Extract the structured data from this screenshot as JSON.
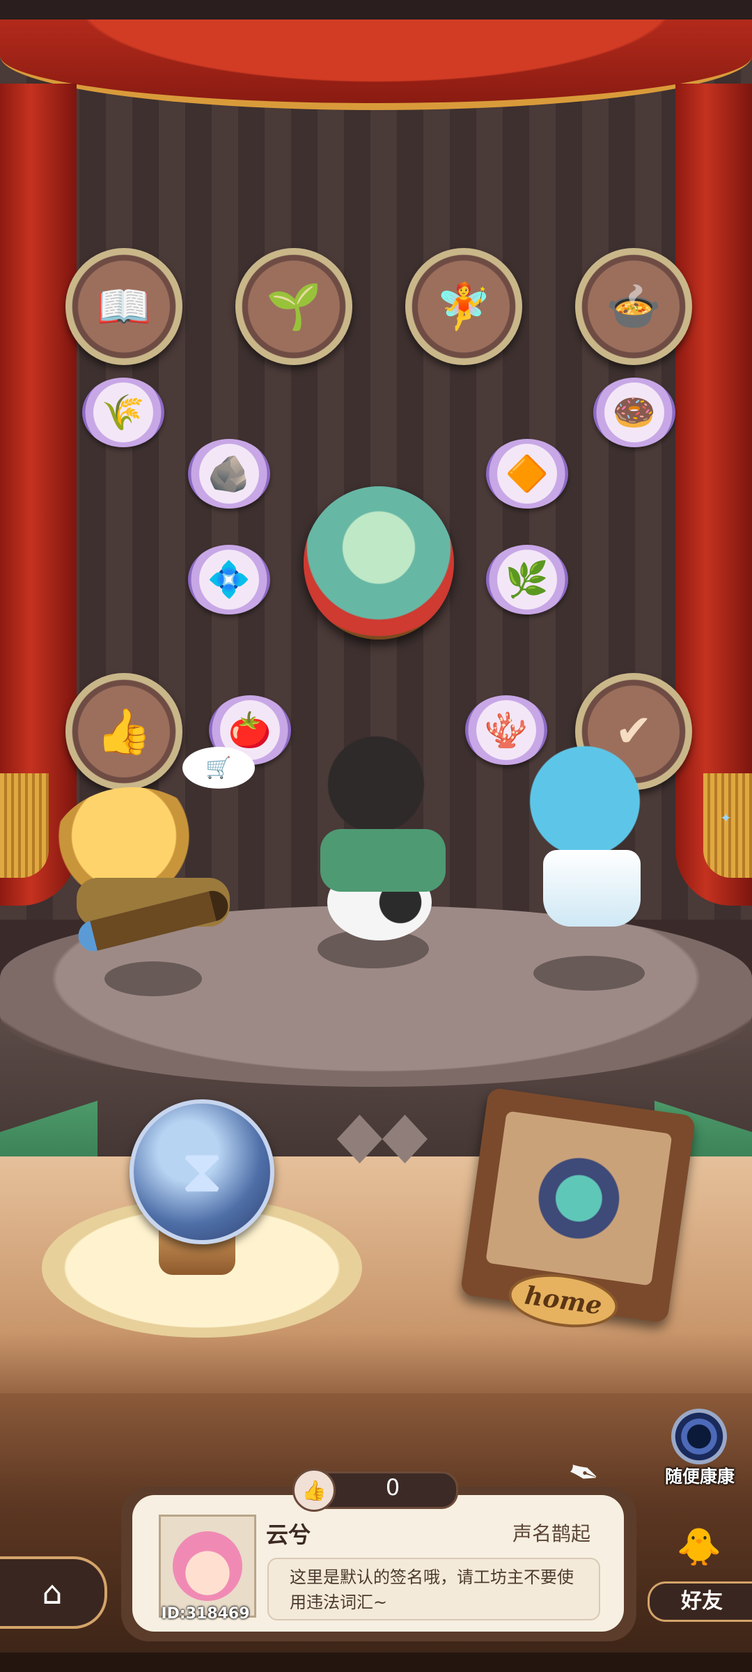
{
  "badges": {
    "top": [
      {
        "icon": "book-icon",
        "glyph": "📖"
      },
      {
        "icon": "sprout-icon",
        "glyph": "🌱"
      },
      {
        "icon": "fairy-icon",
        "glyph": "🧚"
      },
      {
        "icon": "cauldron-icon",
        "glyph": "🍲"
      }
    ],
    "bottom": [
      {
        "icon": "thumb-up-icon",
        "glyph": "👍"
      },
      {
        "icon": "check-icon",
        "glyph": "✔"
      }
    ]
  },
  "tokens": [
    {
      "icon": "wheat-icon",
      "glyph": "🌾"
    },
    {
      "icon": "donut-icon",
      "glyph": "🍩"
    },
    {
      "icon": "ore-icon",
      "glyph": "🪨"
    },
    {
      "icon": "amber-icon",
      "glyph": "🔶"
    },
    {
      "icon": "gem-icon",
      "glyph": "💠"
    },
    {
      "icon": "herb-icon",
      "glyph": "🌿"
    },
    {
      "icon": "tomato-icon",
      "glyph": "🍅"
    },
    {
      "icon": "branch-icon",
      "glyph": "🪸"
    }
  ],
  "random_visit": {
    "label": "随便康康"
  },
  "likes": {
    "count": "0",
    "icon": "thumb-up-icon"
  },
  "profile": {
    "name": "云兮",
    "reputation": "声名鹊起",
    "id": "ID:318469",
    "signature": "这里是默认的签名哦，请工坊主不要使用违法词汇~"
  },
  "home_plate": {
    "label": "home"
  },
  "friends": {
    "label": "好友"
  },
  "colors": {
    "curtain": "#c5321f",
    "fringe": "#e0a840",
    "card": "#f7efe1",
    "wood": "#5c3c2a"
  }
}
